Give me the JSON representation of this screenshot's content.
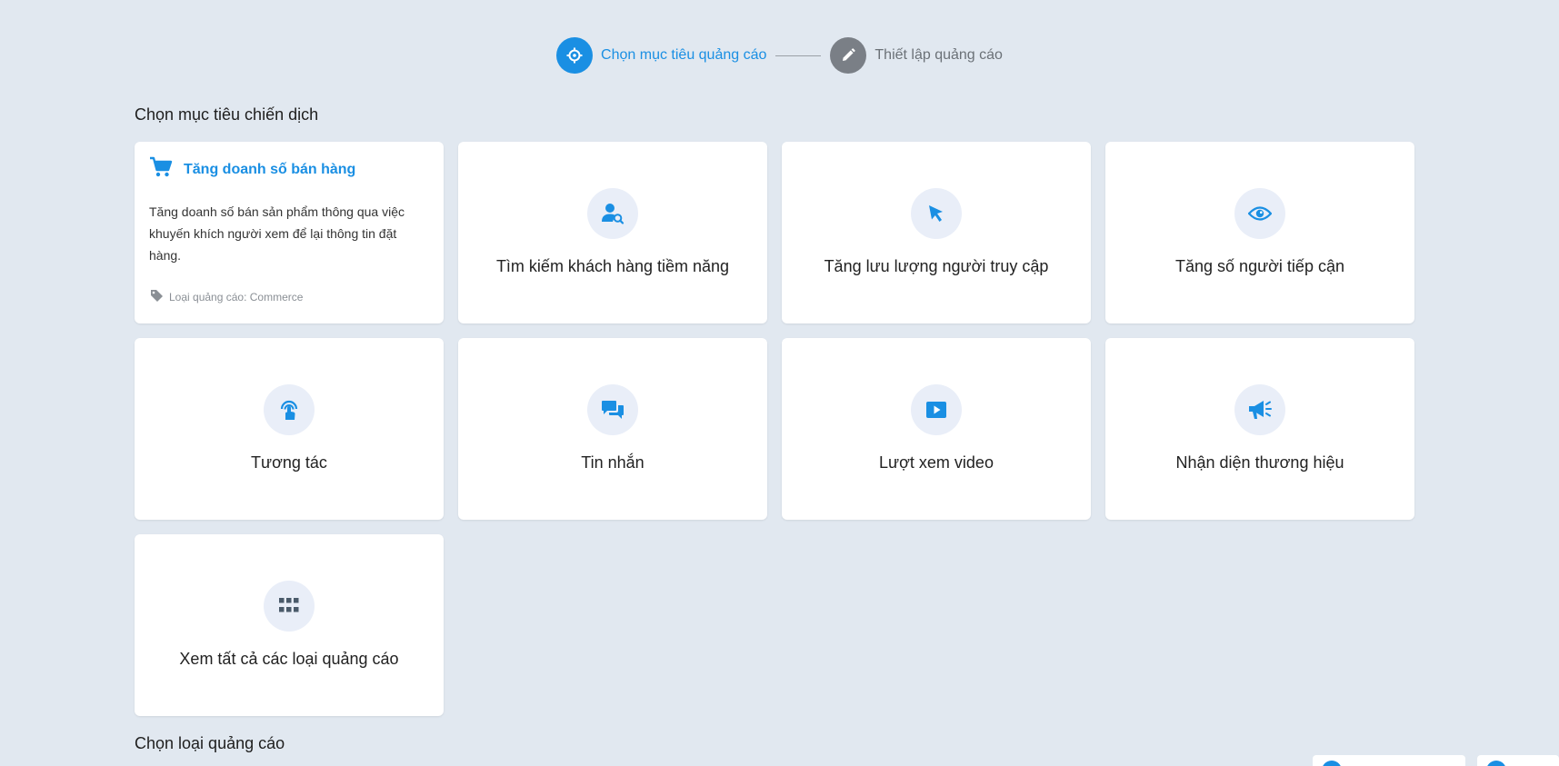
{
  "stepper": {
    "step1_label": "Chọn mục tiêu quảng cáo",
    "step2_label": "Thiết lập quảng cáo"
  },
  "section1_title": "Chọn mục tiêu chiến dịch",
  "section2_title": "Chọn loại quảng cáo",
  "featured": {
    "title": "Tăng doanh số bán hàng",
    "description": "Tăng doanh số bán sản phẩm thông qua việc khuyến khích người xem để lại thông tin đặt hàng.",
    "type_text": "Loại quảng cáo: Commerce",
    "icon": "cart-icon"
  },
  "objectives": [
    {
      "label": "Tìm kiếm khách hàng tiềm năng",
      "icon": "user-search-icon"
    },
    {
      "label": "Tăng lưu lượng người truy cập",
      "icon": "cursor-icon"
    },
    {
      "label": "Tăng số người tiếp cận",
      "icon": "eye-icon"
    },
    {
      "label": "Tương tác",
      "icon": "touch-icon"
    },
    {
      "label": "Tin nhắn",
      "icon": "chat-icon"
    },
    {
      "label": "Lượt xem video",
      "icon": "play-video-icon"
    },
    {
      "label": "Nhận diện thương hiệu",
      "icon": "megaphone-icon"
    },
    {
      "label": "Xem tất cả các loại quảng cáo",
      "icon": "grid-icon"
    }
  ],
  "colors": {
    "accent": "#1a8fe3",
    "background": "#e1e8f0",
    "card": "#ffffff",
    "inactive": "#7a7f86"
  }
}
